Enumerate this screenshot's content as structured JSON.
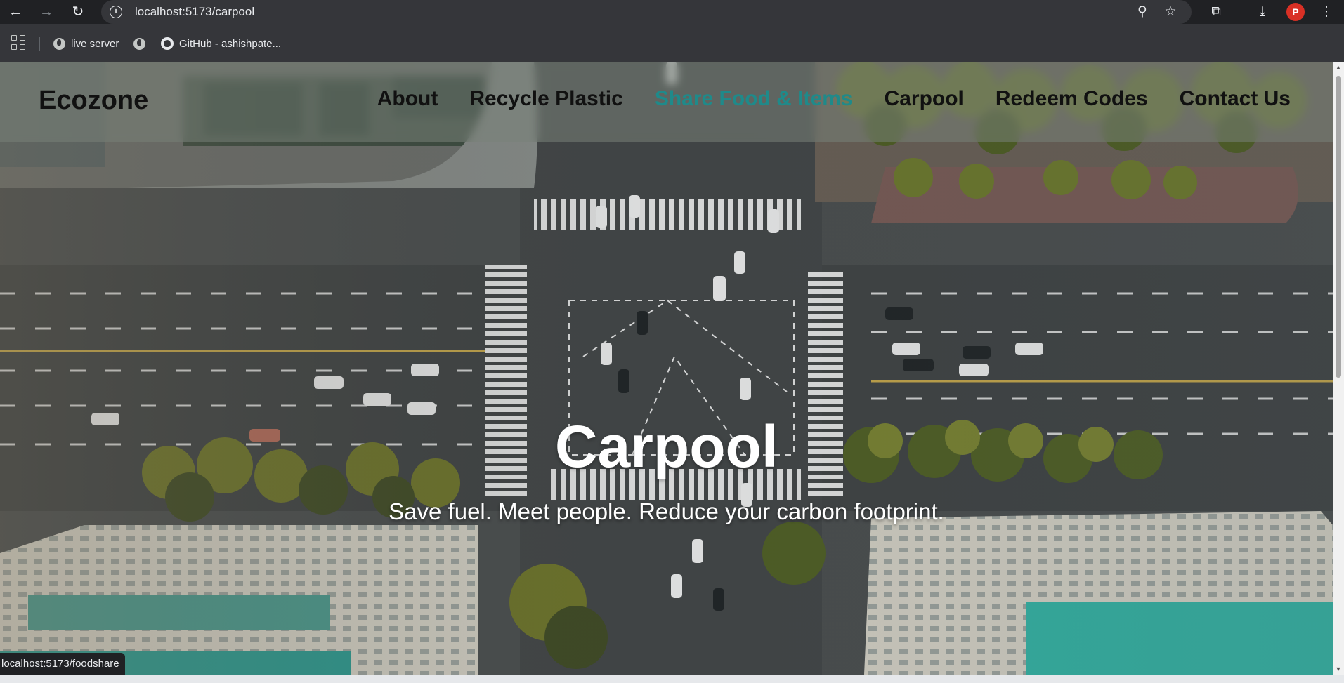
{
  "browser": {
    "url": "localhost:5173/carpool",
    "bookmarks": [
      {
        "label": "live server",
        "icon": "globe-icon"
      },
      {
        "label": "",
        "icon": "globe-icon"
      },
      {
        "label": "GitHub - ashishpate...",
        "icon": "github-icon"
      }
    ],
    "profile_initial": "P",
    "status_url": "localhost:5173/foodshare"
  },
  "site": {
    "brand": "Ecozone",
    "nav": [
      {
        "label": "About"
      },
      {
        "label": "Recycle Plastic"
      },
      {
        "label": "Share Food & Items",
        "active": true
      },
      {
        "label": "Carpool"
      },
      {
        "label": "Redeem Codes"
      },
      {
        "label": "Contact Us"
      }
    ],
    "active_color": "#1f8a8a"
  },
  "hero": {
    "title": "Carpool",
    "subtitle": "Save fuel. Meet people. Reduce your carbon footprint.",
    "background": "aerial-city-intersection"
  }
}
